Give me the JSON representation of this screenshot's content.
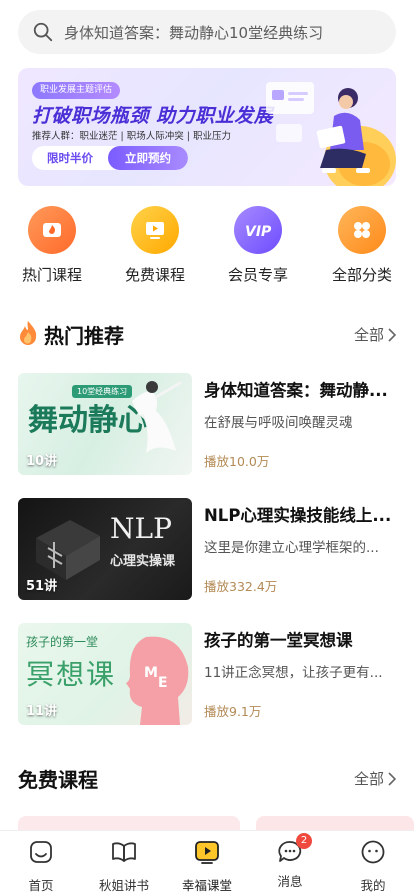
{
  "search": {
    "placeholder": "身体知道答案：舞动静心10堂经典练习"
  },
  "banner": {
    "tag": "职业发展主题评估",
    "title": "打破职场瓶颈 助力职业发展",
    "subtitle": "推荐人群：职业迷茫 | 职场人际冲突 | 职业压力",
    "price_label": "限时半价",
    "cta_label": "立即预约"
  },
  "quick_entries": [
    {
      "label": "热门课程",
      "icon": "flame-icon",
      "color": "#ff7a3a"
    },
    {
      "label": "免费课程",
      "icon": "play-screen-icon",
      "color": "#ffb400"
    },
    {
      "label": "会员专享",
      "icon": "vip-icon",
      "color": "#8a6cff"
    },
    {
      "label": "全部分类",
      "icon": "grid-clover-icon",
      "color": "#ff9a2f"
    }
  ],
  "hot": {
    "title": "热门推荐",
    "more": "全部",
    "courses": [
      {
        "title": "身体知道答案：舞动静...",
        "desc": "在舒展与呼吸间唤醒灵魂",
        "plays": "播放10.0万",
        "lessons": "10讲",
        "thumb_text": "舞动静心",
        "thumb_sub": "10堂经典练习"
      },
      {
        "title": "NLP心理实操技能线上...",
        "desc": "这里是你建立心理学框架的...",
        "plays": "播放332.4万",
        "lessons": "51讲",
        "thumb_text": "NLP",
        "thumb_sub": "心理实操课"
      },
      {
        "title": "孩子的第一堂冥想课",
        "desc": "11讲正念冥想，让孩子更有...",
        "plays": "播放9.1万",
        "lessons": "11讲",
        "thumb_text": "冥想课",
        "thumb_sub": "孩子的第一堂"
      }
    ]
  },
  "free": {
    "title": "免费课程",
    "more": "全部"
  },
  "tabbar": {
    "items": [
      {
        "label": "首页",
        "icon": "home-icon"
      },
      {
        "label": "秋姐讲书",
        "icon": "book-icon"
      },
      {
        "label": "幸福课堂",
        "icon": "classroom-play-icon"
      },
      {
        "label": "消息",
        "icon": "message-icon",
        "badge": "2"
      },
      {
        "label": "我的",
        "icon": "profile-icon"
      }
    ],
    "active_index": 2
  },
  "colors": {
    "accent": "#6b4cf0",
    "plays": "#b38a55",
    "badge": "#f04a3e"
  }
}
